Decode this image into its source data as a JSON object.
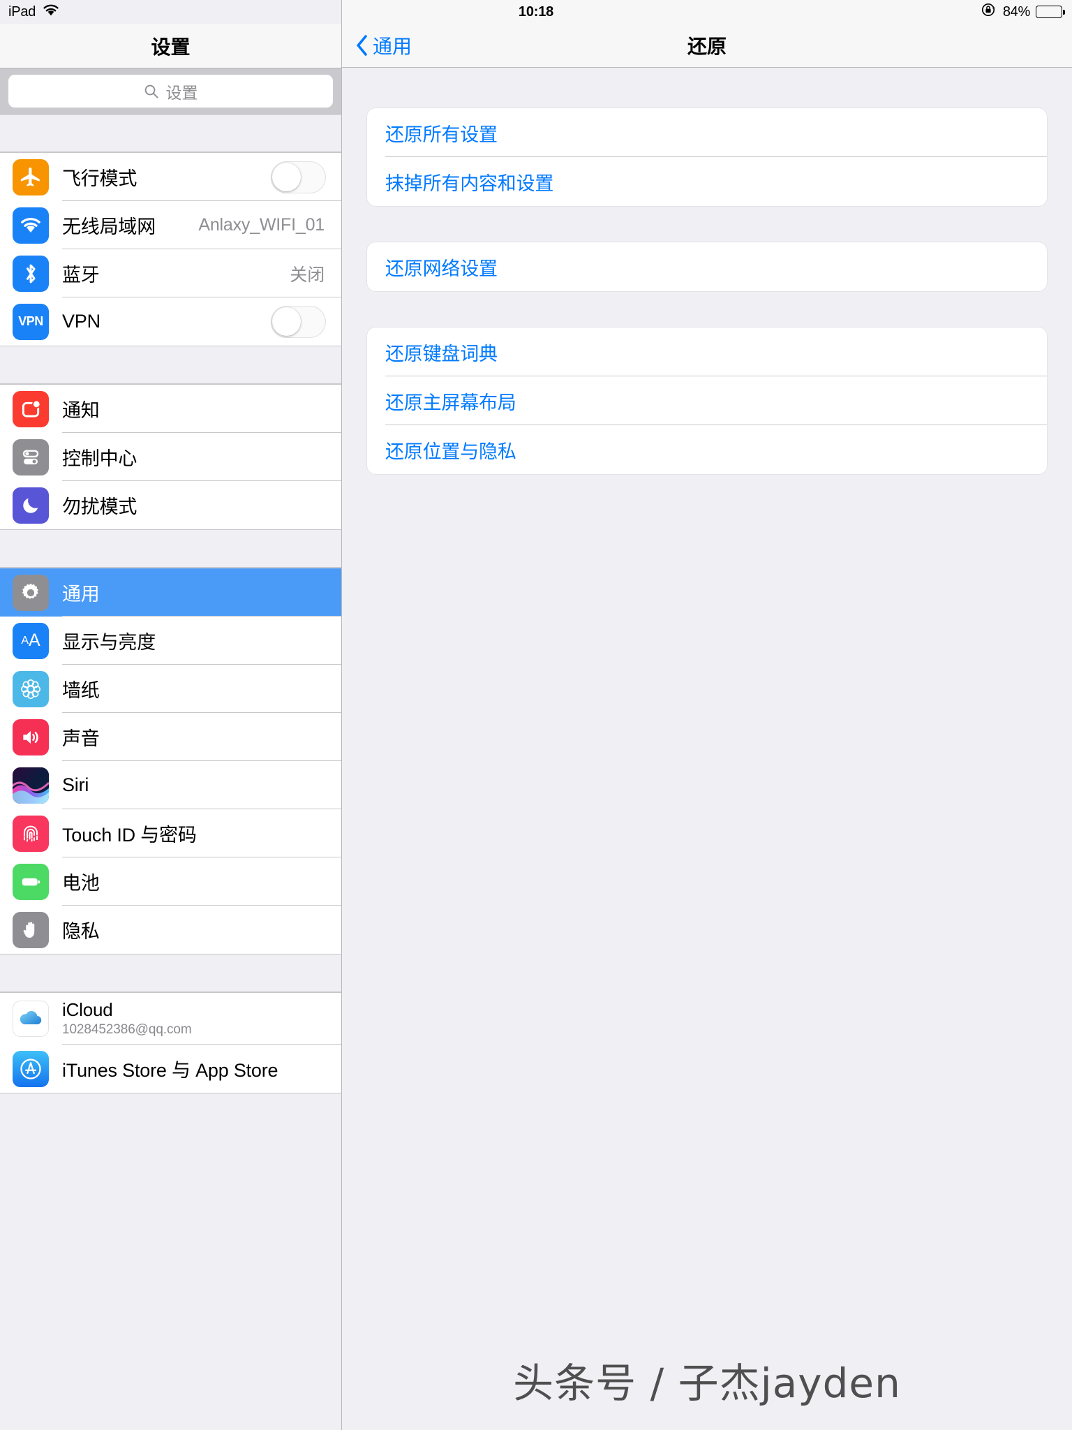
{
  "statusbar": {
    "device": "iPad",
    "wifi_icon": "wifi-icon",
    "time": "10:18",
    "rotation_lock_icon": "rotation-lock-icon",
    "battery_percent": "84%",
    "battery_level": 84
  },
  "sidebar": {
    "title": "设置",
    "search": {
      "placeholder": "设置",
      "value": "",
      "icon": "search-icon"
    },
    "groups": [
      {
        "items": [
          {
            "label": "飞行模式",
            "icon": "airplane-icon",
            "accessory": "toggle",
            "toggle_on": false
          },
          {
            "label": "无线局域网",
            "icon": "wifi-icon",
            "accessory": "value",
            "value": "Anlaxy_WIFI_01"
          },
          {
            "label": "蓝牙",
            "icon": "bluetooth-icon",
            "accessory": "value",
            "value": "关闭"
          },
          {
            "label": "VPN",
            "icon": "vpn-icon",
            "accessory": "toggle",
            "toggle_on": false
          }
        ]
      },
      {
        "items": [
          {
            "label": "通知",
            "icon": "notifications-icon",
            "accessory": "none"
          },
          {
            "label": "控制中心",
            "icon": "control-center-icon",
            "accessory": "none"
          },
          {
            "label": "勿扰模式",
            "icon": "do-not-disturb-icon",
            "accessory": "none"
          }
        ]
      },
      {
        "items": [
          {
            "label": "通用",
            "icon": "general-gear-icon",
            "accessory": "none",
            "selected": true
          },
          {
            "label": "显示与亮度",
            "icon": "display-brightness-icon",
            "accessory": "none"
          },
          {
            "label": "墙纸",
            "icon": "wallpaper-icon",
            "accessory": "none"
          },
          {
            "label": "声音",
            "icon": "sounds-icon",
            "accessory": "none"
          },
          {
            "label": "Siri",
            "icon": "siri-icon",
            "accessory": "none"
          },
          {
            "label": "Touch ID 与密码",
            "icon": "touch-id-icon",
            "accessory": "none"
          },
          {
            "label": "电池",
            "icon": "battery-icon",
            "accessory": "none"
          },
          {
            "label": "隐私",
            "icon": "privacy-icon",
            "accessory": "none"
          }
        ]
      },
      {
        "items": [
          {
            "label": "iCloud",
            "sublabel": "1028452386@qq.com",
            "icon": "icloud-icon",
            "accessory": "none"
          },
          {
            "label": "iTunes Store 与 App Store",
            "icon": "app-store-icon",
            "accessory": "none"
          }
        ]
      }
    ]
  },
  "detail": {
    "back_label": "通用",
    "back_icon": "chevron-left-icon",
    "title": "还原",
    "groups": [
      {
        "items": [
          {
            "label": "还原所有设置"
          },
          {
            "label": "抹掉所有内容和设置"
          }
        ]
      },
      {
        "items": [
          {
            "label": "还原网络设置"
          }
        ]
      },
      {
        "items": [
          {
            "label": "还原键盘词典"
          },
          {
            "label": "还原主屏幕布局"
          },
          {
            "label": "还原位置与隐私"
          }
        ]
      }
    ]
  },
  "watermark": {
    "text": "头条号 / 子杰jayden"
  },
  "colors": {
    "accent": "#007aff",
    "selected_row": "#4a9bf7",
    "airplane": "#f79400",
    "wifi": "#1a82f7",
    "bluetooth": "#1a82f7",
    "vpn": "#1a82f7",
    "notifications": "#fb3b30",
    "control_center": "#8e8e93",
    "do_not_disturb": "#5856d6",
    "general": "#8e8e93",
    "display": "#1a82f7",
    "wallpaper": "#4cb8e8",
    "sounds": "#f62f55",
    "touch_id": "#f8365e",
    "battery": "#4cd964",
    "privacy": "#8e8e93",
    "app_store": "#1a9bf7"
  }
}
